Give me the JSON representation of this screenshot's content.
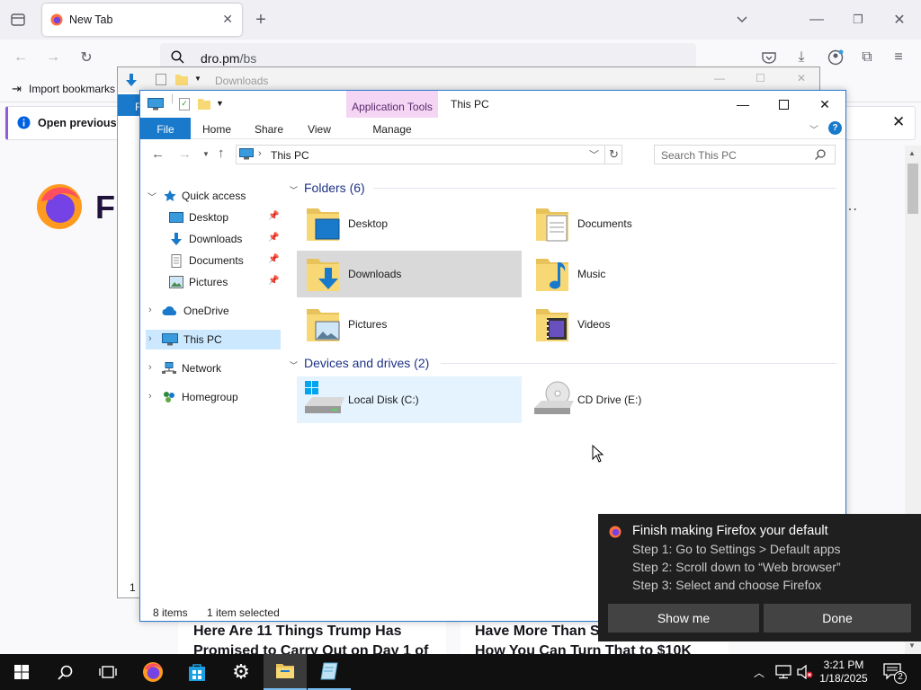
{
  "firefox": {
    "tab_title": "New Tab",
    "url_host": "dro.pm",
    "url_path": "/bs",
    "bookmarks_import_label": "Import bookmarks",
    "infobar_text": "Open previous ta",
    "hero_fragment": "Fi",
    "article_1_title_a": "Here Are 11 Things Trump Has",
    "article_1_title_b": "Promised to Carry Out on Day 1 of",
    "article_2_title_a": "Have More Than S",
    "article_2_title_b": "How You Can Turn That to $10K"
  },
  "back_window": {
    "title": "Downloads",
    "file_tab_fragment": "F",
    "status_fragment": "1"
  },
  "explorer": {
    "context_tab": "Application Tools",
    "caption": "This PC",
    "ribbon_tabs": {
      "file": "File",
      "home": "Home",
      "share": "Share",
      "view": "View",
      "manage": "Manage"
    },
    "address_location": "This PC",
    "search_placeholder": "Search This PC",
    "nav": {
      "quick_access": "Quick access",
      "desktop": "Desktop",
      "downloads": "Downloads",
      "documents": "Documents",
      "pictures": "Pictures",
      "onedrive": "OneDrive",
      "this_pc": "This PC",
      "network": "Network",
      "homegroup": "Homegroup"
    },
    "folders_header": "Folders (6)",
    "folders": {
      "desktop": "Desktop",
      "documents": "Documents",
      "downloads": "Downloads",
      "music": "Music",
      "pictures": "Pictures",
      "videos": "Videos"
    },
    "devices_header": "Devices and drives (2)",
    "drives": {
      "local_disk": "Local Disk (C:)",
      "cd_drive": "CD Drive (E:)"
    },
    "status_items": "8 items",
    "status_selected": "1 item selected"
  },
  "toast": {
    "title": "Finish making Firefox your default",
    "step1": "Step 1: Go to Settings > Default apps",
    "step2": "Step 2: Scroll down to “Web browser”",
    "step3": "Step 3: Select and choose Firefox",
    "show_me": "Show me",
    "done": "Done"
  },
  "taskbar": {
    "time": "3:21 PM",
    "date": "1/18/2025",
    "notification_count": "2"
  },
  "colors": {
    "accent_blue": "#1979ca",
    "selection": "#cce8ff",
    "context_tab": "#f4d6f4",
    "group_header": "#1e3287",
    "toast_bg": "#1f1f1f",
    "taskbar_bg": "#101010"
  },
  "icons": [
    "firefox-icon",
    "folder-icon",
    "drive-icon",
    "cd-drive-icon",
    "search-icon",
    "star-icon",
    "cloud-icon",
    "monitor-icon",
    "network-icon",
    "homegroup-icon",
    "pin-icon",
    "windows-icon",
    "settings-icon"
  ]
}
